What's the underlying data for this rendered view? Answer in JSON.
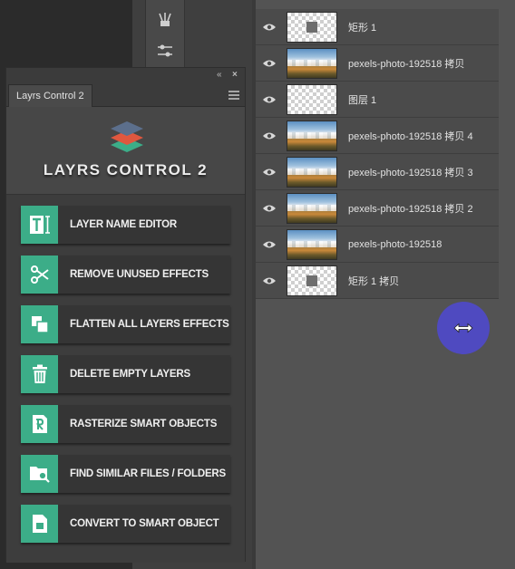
{
  "layrs_panel": {
    "tab_label": "Layrs Control 2",
    "title": "LAYRS CONTROL 2",
    "buttons": [
      {
        "label": "LAYER NAME EDITOR",
        "icon": "text-edit-icon"
      },
      {
        "label": "REMOVE UNUSED EFFECTS",
        "icon": "scissors-icon"
      },
      {
        "label": "FLATTEN ALL LAYERS EFFECTS",
        "icon": "flatten-icon"
      },
      {
        "label": "DELETE EMPTY LAYERS",
        "icon": "trash-icon"
      },
      {
        "label": "RASTERIZE SMART OBJECTS",
        "icon": "rasterize-icon"
      },
      {
        "label": "FIND SIMILAR FILES  / FOLDERS",
        "icon": "folder-search-icon"
      },
      {
        "label": "CONVERT TO SMART OBJECT",
        "icon": "smart-object-icon"
      }
    ],
    "accent_color": "#3cad88"
  },
  "layers": [
    {
      "name": "矩形 1",
      "thumb": "shape"
    },
    {
      "name": "pexels-photo-192518 拷贝",
      "thumb": "photo"
    },
    {
      "name": "图层 1",
      "thumb": "empty"
    },
    {
      "name": "pexels-photo-192518 拷贝 4",
      "thumb": "photo"
    },
    {
      "name": "pexels-photo-192518 拷贝 3",
      "thumb": "photo"
    },
    {
      "name": "pexels-photo-192518 拷贝 2",
      "thumb": "photo"
    },
    {
      "name": "pexels-photo-192518",
      "thumb": "photo"
    },
    {
      "name": "矩形 1 拷贝",
      "thumb": "shape"
    }
  ],
  "cursor": {
    "icon": "resize-horizontal-cursor-icon",
    "color": "#4f4ac0"
  }
}
